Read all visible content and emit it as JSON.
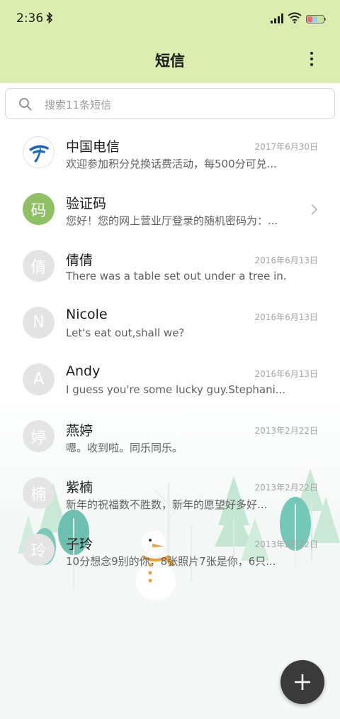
{
  "status_bar": {
    "time": "2:36"
  },
  "appbar": {
    "title": "短信"
  },
  "search": {
    "placeholder": "搜索11条短信"
  },
  "conversations": [
    {
      "name": "中国电信",
      "preview": "欢迎参加积分兑换话费活动，每500分可兑...",
      "date": "2017年6月30日",
      "avatar": ""
    },
    {
      "name": "验证码",
      "preview": "您好！您的网上营业厅登录的随机密码为：...",
      "date": "",
      "avatar": "码"
    },
    {
      "name": "倩倩",
      "preview": "There was a table set out under a tree in...",
      "date": "2016年6月13日",
      "avatar": "倩"
    },
    {
      "name": "Nicole",
      "preview": "Let's eat out,shall we?",
      "date": "2016年6月13日",
      "avatar": "N"
    },
    {
      "name": "Andy",
      "preview": "I guess you're some lucky guy.Stephani...",
      "date": "2016年6月13日",
      "avatar": "A"
    },
    {
      "name": "燕婷",
      "preview": "嗯。收到啦。同乐同乐。",
      "date": "2013年2月22日",
      "avatar": "婷"
    },
    {
      "name": "紫楠",
      "preview": "新年的祝福数不胜数，新年的愿望好多好...",
      "date": "2013年2月22日",
      "avatar": "楠"
    },
    {
      "name": "子玲",
      "preview": "10分想念9别的你，8张照片7张是你，6只...",
      "date": "2013年2月22日",
      "avatar": "玲"
    }
  ],
  "colors": {
    "header_bg": "#dcedb0",
    "fab_bg": "#3a3a3a",
    "avatar_green": "#8dc164"
  }
}
